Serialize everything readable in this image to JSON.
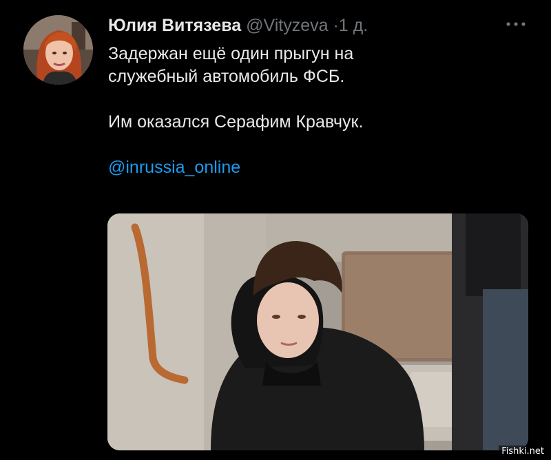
{
  "author": {
    "name": "Юлия Витязева",
    "handle": "@Vityzeva",
    "separator": "·",
    "time": "1 д."
  },
  "tweet": {
    "lines": [
      "Задержан ещё один прыгун на",
      "служебный автомобиль ФСБ."
    ],
    "line3": "Им оказался Серафим Кравчук.",
    "mention": "@inrussia_online"
  },
  "icons": {
    "avatar": "user-avatar",
    "more": "more-horizontal-icon",
    "media": "tweet-photo"
  },
  "colors": {
    "background": "#000000",
    "text": "#e7e9ea",
    "muted": "#71767b",
    "link": "#1d9bf0"
  },
  "watermark": "Fishki.net"
}
